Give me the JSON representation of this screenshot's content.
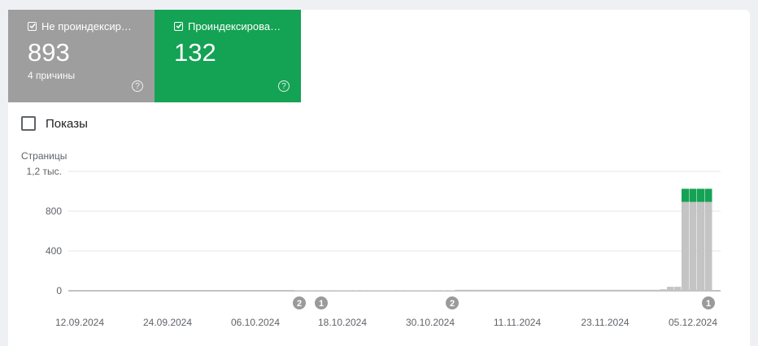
{
  "tiles": [
    {
      "label": "Не проиндексир…",
      "value": "893",
      "sub": "4 причины",
      "color": "#9e9e9e",
      "checked": true
    },
    {
      "label": "Проиндексирова…",
      "value": "132",
      "sub": "",
      "color": "#14a254",
      "checked": true
    }
  ],
  "impressions_label": "Показы",
  "chart_data": {
    "type": "bar",
    "ylabel": "Страницы",
    "ytick_labels": [
      "1,2 тыс.",
      "800",
      "400",
      "0"
    ],
    "ytick_values": [
      1200,
      800,
      400,
      0
    ],
    "ylim": [
      0,
      1200
    ],
    "xtick_labels": [
      "12.09.2024",
      "24.09.2024",
      "06.10.2024",
      "18.10.2024",
      "30.10.2024",
      "11.11.2024",
      "23.11.2024",
      "05.12.2024"
    ],
    "series": [
      {
        "name": "Не проиндексированы",
        "color": "#c4c4c4"
      },
      {
        "name": "Проиндексированы",
        "color": "#14a254"
      }
    ],
    "bars": [
      {
        "gray": 5,
        "green": 0,
        "count": 22
      },
      {
        "gray": 10,
        "green": 0,
        "count": 28
      },
      {
        "gray": 15,
        "green": 0,
        "count": 1
      },
      {
        "gray": 40,
        "green": 0,
        "count": 2
      },
      {
        "gray": 893,
        "green": 132,
        "count": 4
      }
    ],
    "annotations": [
      {
        "label": "2",
        "x_index": 0
      },
      {
        "label": "1",
        "x_index": 1
      },
      {
        "label": "2",
        "x_index": 2
      },
      {
        "label": "1",
        "x_index": 3
      }
    ],
    "grid": true
  }
}
